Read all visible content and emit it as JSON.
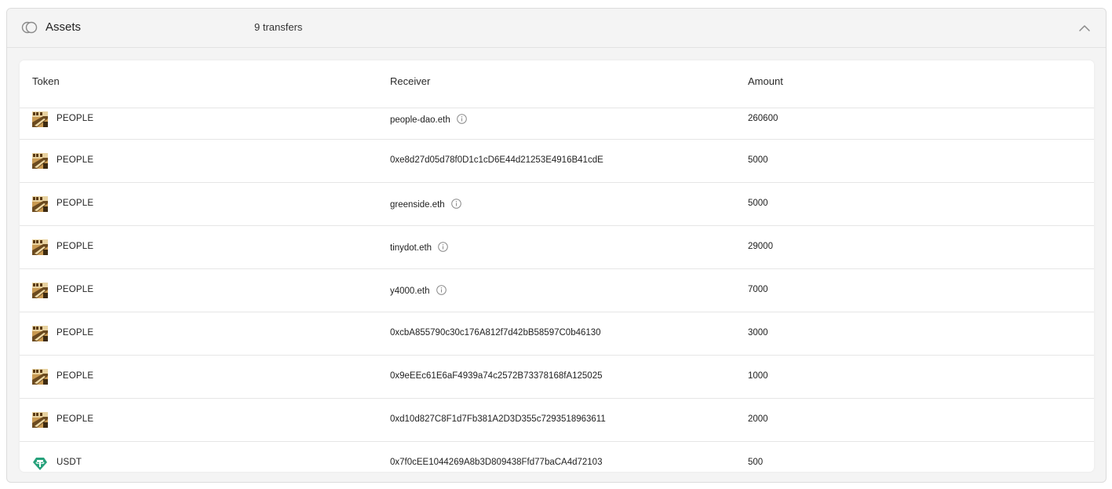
{
  "header": {
    "title": "Assets",
    "count_label": "9 transfers",
    "icon": "coins-icon",
    "collapse_icon": "chevron-up-icon"
  },
  "table": {
    "columns": [
      "Token",
      "Receiver",
      "Amount"
    ],
    "rows": [
      {
        "token": "PEOPLE",
        "token_icon": "people-token-icon",
        "receiver": "people-dao.eth",
        "info": true,
        "amount": "260600"
      },
      {
        "token": "PEOPLE",
        "token_icon": "people-token-icon",
        "receiver": "0xe8d27d05d78f0D1c1cD6E44d21253E4916B41cdE",
        "info": false,
        "amount": "5000"
      },
      {
        "token": "PEOPLE",
        "token_icon": "people-token-icon",
        "receiver": "greenside.eth",
        "info": true,
        "amount": "5000"
      },
      {
        "token": "PEOPLE",
        "token_icon": "people-token-icon",
        "receiver": "tinydot.eth",
        "info": true,
        "amount": "29000"
      },
      {
        "token": "PEOPLE",
        "token_icon": "people-token-icon",
        "receiver": "y4000.eth",
        "info": true,
        "amount": "7000"
      },
      {
        "token": "PEOPLE",
        "token_icon": "people-token-icon",
        "receiver": "0xcbA855790c30c176A812f7d42bB58597C0b46130",
        "info": false,
        "amount": "3000"
      },
      {
        "token": "PEOPLE",
        "token_icon": "people-token-icon",
        "receiver": "0x9eEEc61E6aF4939a74c2572B73378168fA125025",
        "info": false,
        "amount": "1000"
      },
      {
        "token": "PEOPLE",
        "token_icon": "people-token-icon",
        "receiver": "0xd10d827C8F1d7Fb381A2D3D355c7293518963611",
        "info": false,
        "amount": "2000"
      },
      {
        "token": "USDT",
        "token_icon": "usdt-token-icon",
        "receiver": "0x7f0cEE1044269A8b3D809438Ffd77baCA4d72103",
        "info": false,
        "amount": "500"
      }
    ]
  },
  "colors": {
    "panel_bg": "#f4f4f4",
    "card_bg": "#ffffff",
    "border": "#e6e6e6",
    "usdt": "#26a17b",
    "people_dark": "#6b4a1f",
    "people_light": "#d8b06a"
  }
}
